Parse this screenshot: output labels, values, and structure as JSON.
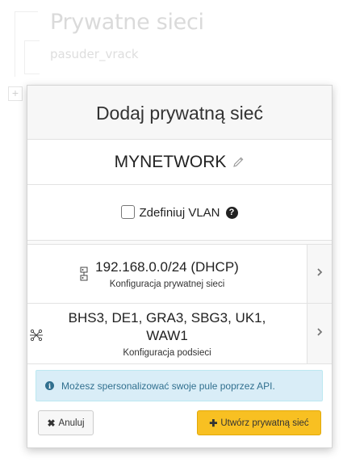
{
  "background": {
    "title": "Prywatne sieci",
    "subtitle": "pasuder_vrack",
    "plus_icon": "+"
  },
  "modal": {
    "title": "Dodaj prywatną sieć",
    "network_name": "MYNETWORK",
    "edit_icon": "pencil-icon",
    "vlan": {
      "label": "Zdefiniuj VLAN",
      "checked": false,
      "help_glyph": "?"
    },
    "private_network": {
      "value": "192.168.0.0/24 (DHCP)",
      "caption": "Konfiguracja prywatnej sieci",
      "icon": "network-nodes-icon"
    },
    "subnet": {
      "value_line1": "BHS3, DE1, GRA3, SBG3, UK1,",
      "value_line2": "WAW1",
      "caption": "Konfiguracja podsieci",
      "icon": "region-star-icon"
    },
    "info": {
      "icon_glyph": "i",
      "text": "Możesz spersonalizować swoje pule poprzez API."
    },
    "cancel": {
      "icon": "✖",
      "label": "Anuluj"
    },
    "create": {
      "icon": "✚",
      "label": "Utwórz prywatną sieć"
    },
    "colors": {
      "primary_button": "#f8c022",
      "info_bg": "#d9edf7",
      "info_text": "#31708f"
    }
  }
}
